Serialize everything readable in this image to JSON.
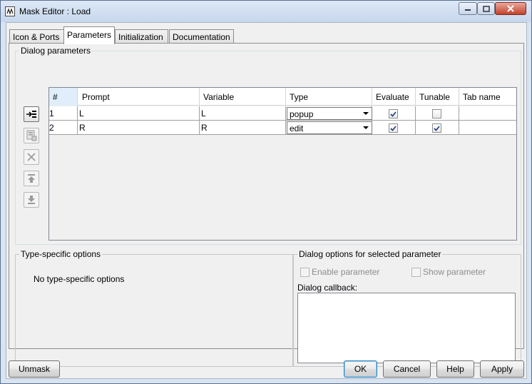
{
  "window": {
    "title": "Mask Editor : Load"
  },
  "tabs": [
    {
      "label": "Icon & Ports",
      "active": false
    },
    {
      "label": "Parameters",
      "active": true
    },
    {
      "label": "Initialization",
      "active": false
    },
    {
      "label": "Documentation",
      "active": false
    }
  ],
  "dialog_parameters": {
    "group_title": "Dialog parameters",
    "side_buttons": [
      {
        "icon": "add-parameter-icon",
        "enabled": true
      },
      {
        "icon": "copy-parameter-icon",
        "enabled": false
      },
      {
        "icon": "delete-icon",
        "enabled": false
      },
      {
        "icon": "move-up-icon",
        "enabled": false
      },
      {
        "icon": "move-down-icon",
        "enabled": false
      }
    ],
    "columns": [
      "#",
      "Prompt",
      "Variable",
      "Type",
      "Evaluate",
      "Tunable",
      "Tab name"
    ],
    "rows": [
      {
        "num": "1",
        "prompt": "L",
        "variable": "L",
        "type": "popup",
        "evaluate": true,
        "tunable": false,
        "tab_name": ""
      },
      {
        "num": "2",
        "prompt": "R",
        "variable": "R",
        "type": "edit",
        "evaluate": true,
        "tunable": true,
        "tab_name": ""
      }
    ]
  },
  "type_specific": {
    "group_title": "Type-specific options",
    "message": "No type-specific options"
  },
  "dialog_options": {
    "group_title": "Dialog options for selected parameter",
    "enable_parameter": {
      "label": "Enable parameter",
      "checked": false,
      "enabled": false
    },
    "show_parameter": {
      "label": "Show parameter",
      "checked": false,
      "enabled": false
    },
    "callback_label": "Dialog callback:",
    "callback_value": ""
  },
  "buttons": {
    "unmask": "Unmask",
    "ok": "OK",
    "cancel": "Cancel",
    "help": "Help",
    "apply": "Apply"
  }
}
